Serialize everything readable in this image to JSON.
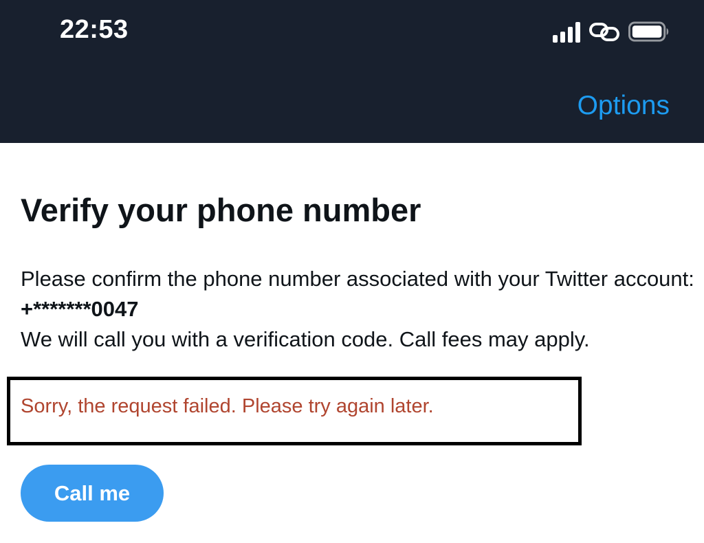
{
  "status_bar": {
    "time": "22:53",
    "icons": [
      "signal-icon",
      "link-icon",
      "battery-icon"
    ]
  },
  "header": {
    "options_label": "Options",
    "options_color": "#1d9bf0",
    "background": "#18202e"
  },
  "main": {
    "title": "Verify your phone number",
    "description_prefix": "Please confirm the phone number associated with your Twitter account: ",
    "masked_phone": "+*******0047",
    "call_note": "We will call you with a verification code. Call fees may apply.",
    "error_message": "Sorry, the request failed. Please try again later.",
    "error_color": "#b0452f",
    "call_button_label": "Call me",
    "call_button_color": "#3b9cf0"
  }
}
